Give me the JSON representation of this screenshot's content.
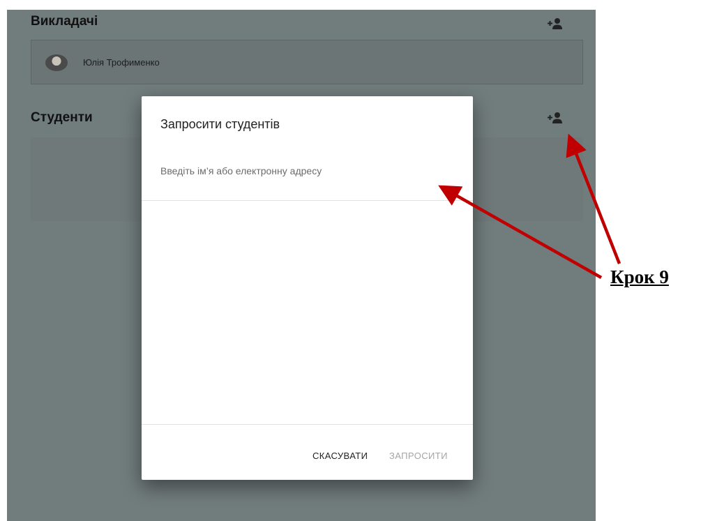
{
  "teachers": {
    "title": "Викладачі",
    "add_icon": "person-add-icon",
    "items": [
      {
        "name": "Юлія Трофименко"
      }
    ]
  },
  "students": {
    "title": "Студенти",
    "add_icon": "person-add-icon"
  },
  "invite_dialog": {
    "title": "Запросити студентів",
    "input_placeholder": "Введіть ім’я або електронну адресу",
    "input_value": "",
    "cancel_label": "СКАСУВАТИ",
    "invite_label": "ЗАПРОСИТИ"
  },
  "annotation": {
    "step_label": "Крок 9",
    "arrow_color": "#c00000"
  },
  "colors": {
    "overlay": "#717c7d",
    "dialog_bg": "#ffffff",
    "disabled_text": "#a5a5a5"
  }
}
